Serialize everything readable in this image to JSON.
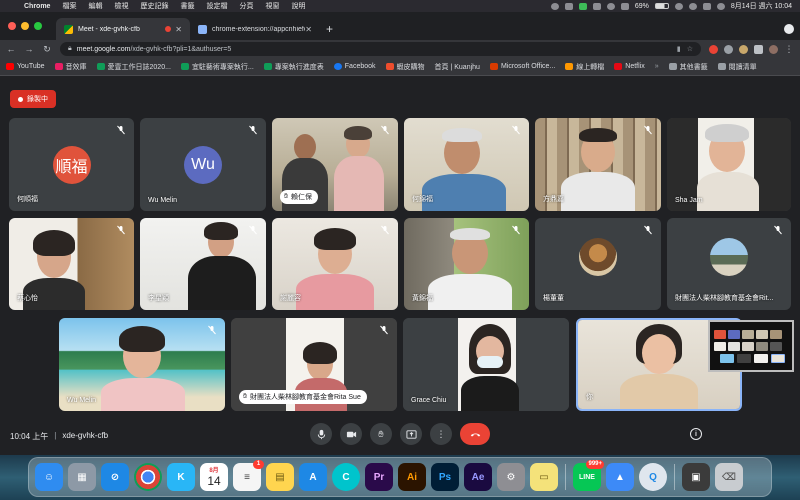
{
  "menubar": {
    "app_name": "Chrome",
    "items": [
      "檔案",
      "編輯",
      "檢視",
      "歷史記錄",
      "書籤",
      "設定檔",
      "分頁",
      "視窗",
      "說明"
    ],
    "battery": "69%",
    "clock": "8月14日 週六  10:04"
  },
  "browser": {
    "tabs": [
      {
        "title": "Meet - xde-gvhk-cfb",
        "active": true
      },
      {
        "title": "chrome-extension://appcnhiefcid",
        "active": false
      }
    ],
    "url_host": "meet.google.com",
    "url_path": "/xde-gvhk-cfb?pli=1&authuser=5",
    "bookmarks": [
      "YouTube",
      "音效庫",
      "愛壹工作日誌2020...",
      "宜駐藝術專案執行...",
      "專案執行進度表",
      "Facebook",
      "蝦皮購物",
      "首頁 | Kuanjhu",
      "Microsoft Office...",
      "線上轉檔",
      "Netflix",
      "其他書籤",
      "閱讀清單"
    ],
    "bookmark_colors": [
      "#ff0000",
      "#e91e63",
      "#0f9d58",
      "#0f9d58",
      "#0f9d58",
      "#1877f2",
      "#ee4d2d",
      "#444444",
      "#d83b01",
      "#ff9800",
      "#e50914",
      "#9aa0a6",
      "#9aa0a6"
    ]
  },
  "meet": {
    "recording_label": "錄製中",
    "meeting_time": "10:04 上午",
    "meeting_code": "xde-gvhk-cfb",
    "participants": [
      {
        "name": "何順福",
        "avatar_text": "順福",
        "avatar_color": "#e0533b"
      },
      {
        "name": "Wu Melin",
        "avatar_text": "Wu",
        "avatar_color": "#5c6bc0"
      },
      {
        "name": "賴仁保",
        "hand_raised": true
      },
      {
        "name": "何錦福"
      },
      {
        "name": "方鼎嘉"
      },
      {
        "name": "Sha Jam"
      },
      {
        "name": "蔡心怡"
      },
      {
        "name": "李星穎"
      },
      {
        "name": "謝麗容"
      },
      {
        "name": "黃錦福"
      },
      {
        "name": "楊董董"
      },
      {
        "name": "財團法人柴林腳教育基金會Rit..."
      },
      {
        "name": "Wu Melin"
      },
      {
        "name": "財團法人柴林腳教育基金會Rita Sue",
        "hand_raised": true
      },
      {
        "name": "Grace Chiu"
      },
      {
        "name": "你"
      }
    ]
  },
  "dock": {
    "apps": [
      {
        "name": "Finder",
        "label": "☺",
        "color": "#2f8cf0"
      },
      {
        "name": "Launchpad",
        "label": "▦",
        "color": "#8d99a6"
      },
      {
        "name": "Safari",
        "label": "⊘",
        "color": "#1e88e5"
      },
      {
        "name": "Chrome",
        "label": "●",
        "color": "#db4437"
      },
      {
        "name": "Kuanjhu",
        "label": "K",
        "color": "#29b6f6"
      },
      {
        "name": "Calendar",
        "label": "8月",
        "day": "14",
        "color": "#ffffff"
      },
      {
        "name": "Reminders",
        "label": "≡",
        "color": "#f5f5f5",
        "badge": "1"
      },
      {
        "name": "Notes",
        "label": "▤",
        "color": "#ffd54f"
      },
      {
        "name": "App Store",
        "label": "A",
        "color": "#1e88e5"
      },
      {
        "name": "Canva",
        "label": "C",
        "color": "#00c4cc"
      },
      {
        "name": "Premiere",
        "label": "Pr",
        "color": "#2a0a4a"
      },
      {
        "name": "Illustrator",
        "label": "Ai",
        "color": "#2b1400"
      },
      {
        "name": "Photoshop",
        "label": "Ps",
        "color": "#001e36"
      },
      {
        "name": "After Effects",
        "label": "Ae",
        "color": "#1a0a40"
      },
      {
        "name": "System Preferences",
        "label": "⚙",
        "color": "#8e8e93"
      },
      {
        "name": "Stickies",
        "label": "▭",
        "color": "#f4e27a"
      },
      {
        "name": "LINE",
        "label": "LINE",
        "color": "#06c755",
        "badge": "999+"
      },
      {
        "name": "Keynote",
        "label": "▲",
        "color": "#3d8af7"
      },
      {
        "name": "QuickTime",
        "label": "Q",
        "color": "#dfe6ee"
      },
      {
        "name": "Screen",
        "label": "▣",
        "color": "#3b3b3b"
      },
      {
        "name": "Trash",
        "label": "⌫",
        "color": "#c8ccd0"
      }
    ]
  }
}
